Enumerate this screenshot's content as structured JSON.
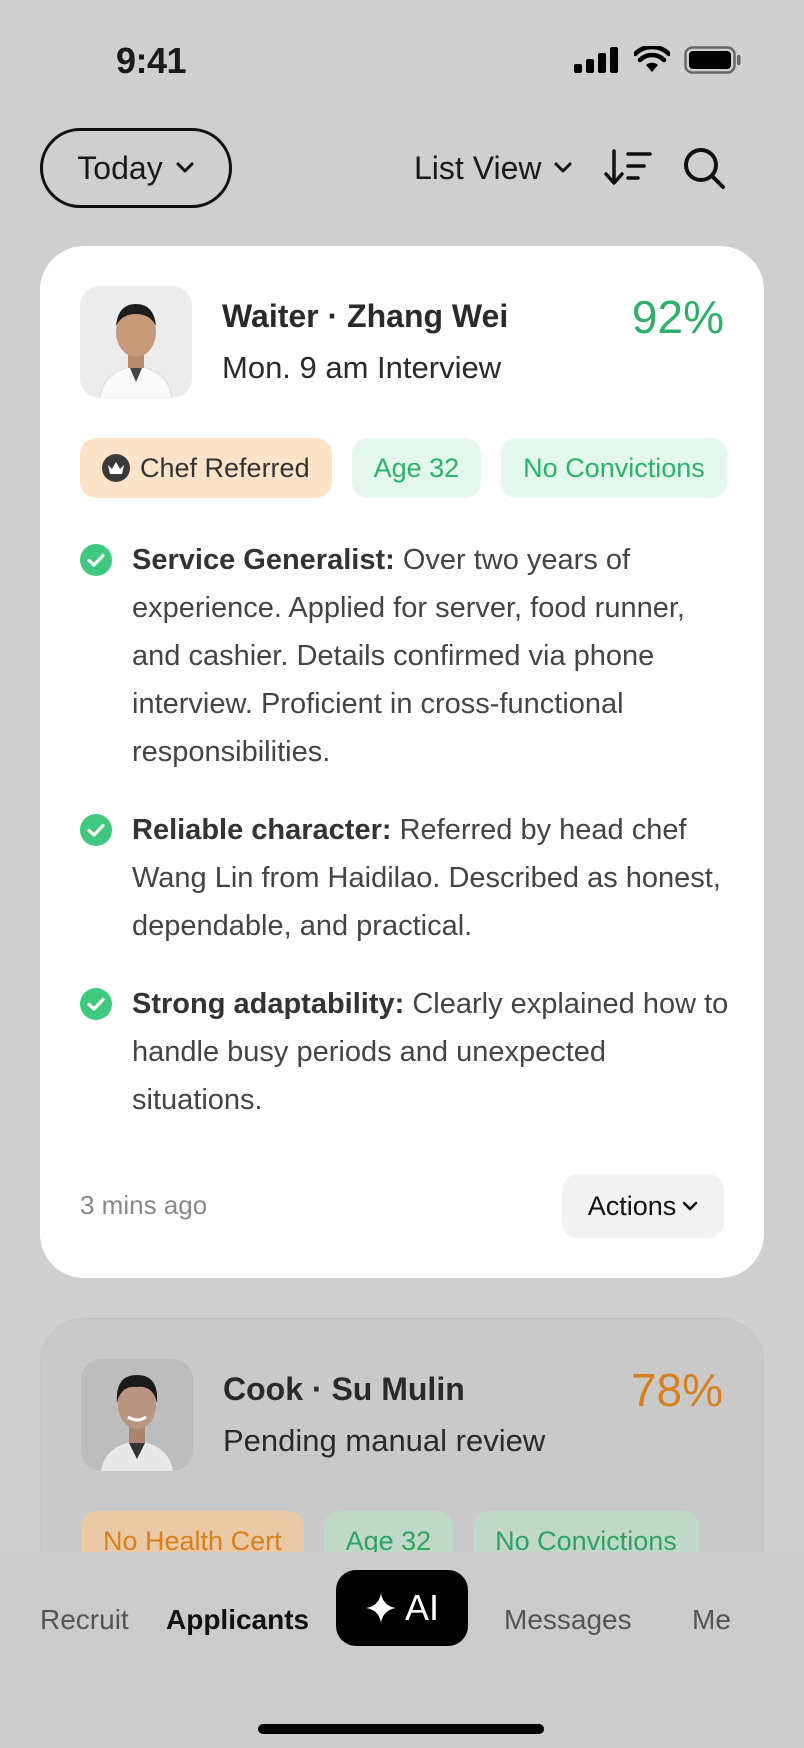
{
  "status": {
    "time": "9:41"
  },
  "toolbar": {
    "date_filter": "Today",
    "view_mode": "List View",
    "icons": [
      "chevron-down-icon",
      "sort-icon",
      "search-icon"
    ]
  },
  "applicants": [
    {
      "title": "Waiter · Zhang Wei",
      "subtitle": "Mon. 9 am Interview",
      "score": "92%",
      "score_color": "#2fb06a",
      "tags": [
        {
          "label": "Chef Referred",
          "type": "orange",
          "icon": "crown-icon"
        },
        {
          "label": "Age 32",
          "type": "green"
        },
        {
          "label": "No Convictions",
          "type": "green"
        }
      ],
      "points": [
        {
          "title": "Service Generalist:",
          "text": " Over two years of experience. Applied for server, food runner, and cashier. Details confirmed via phone interview. Proficient in cross-functional responsibilities."
        },
        {
          "title": "Reliable character:",
          "text": " Referred by head chef Wang Lin from Haidilao. Described as honest, dependable, and practical."
        },
        {
          "title": "Strong adaptability:",
          "text": " Clearly explained how to handle busy periods and unexpected situations."
        }
      ],
      "time_ago": "3 mins ago",
      "actions_label": "Actions"
    },
    {
      "title": "Cook · Su Mulin",
      "subtitle": "Pending manual review",
      "score": "78%",
      "score_color": "#d9801c",
      "tags": [
        {
          "label": "No Health Cert",
          "type": "orange"
        },
        {
          "label": "Age 32",
          "type": "green"
        },
        {
          "label": "No Convictions",
          "type": "green"
        }
      ]
    }
  ],
  "nav": {
    "recruit": "Recruit",
    "applicants": "Applicants",
    "ai": "AI",
    "messages": "Messages",
    "me": "Me"
  }
}
